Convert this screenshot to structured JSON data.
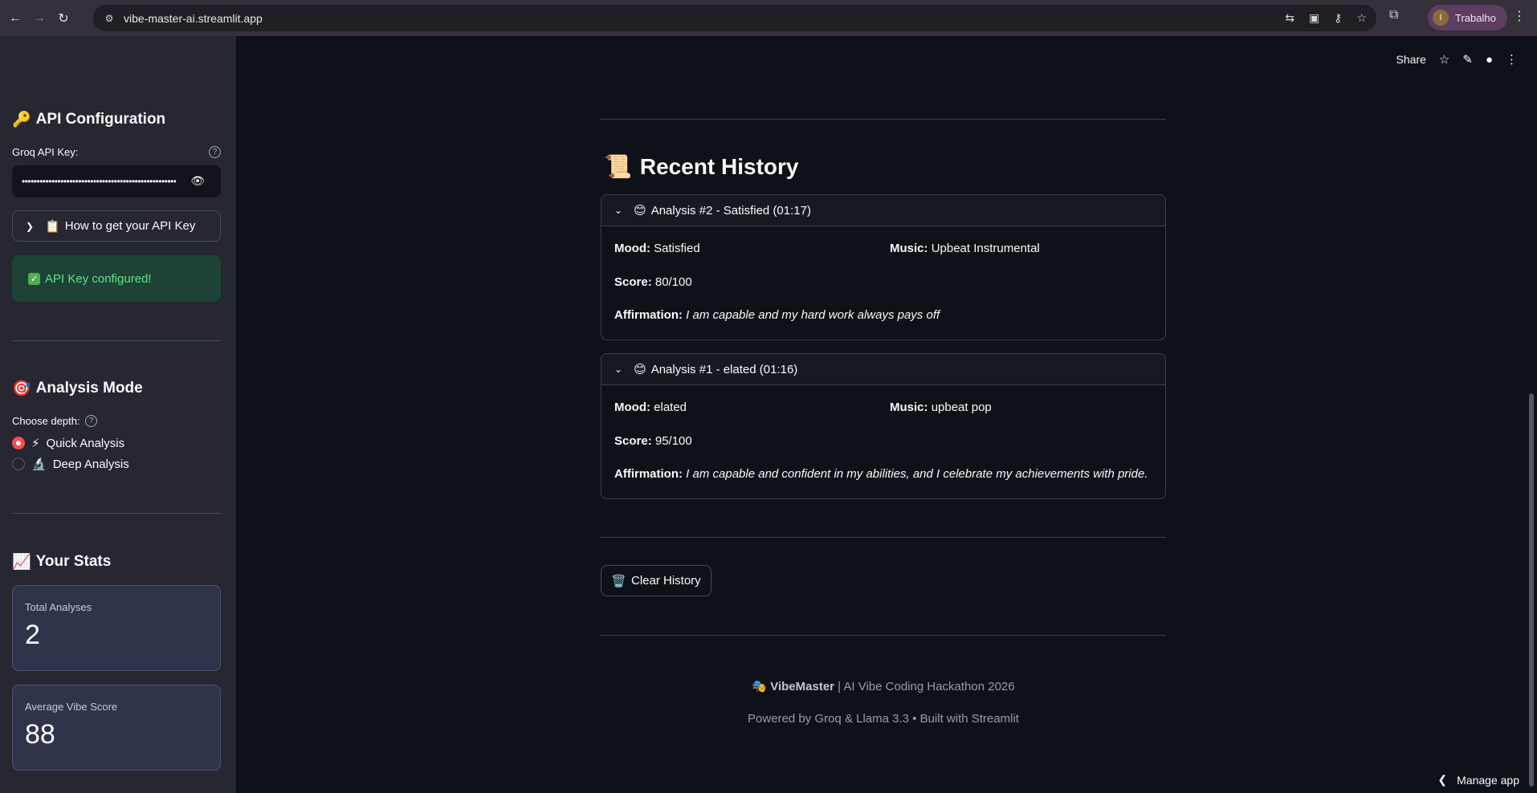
{
  "browser": {
    "url": "vibe-master-ai.streamlit.app",
    "profile_initial": "I",
    "profile_name": "Trabalho"
  },
  "sidebar": {
    "api": {
      "heading_emoji": "🔑",
      "heading": "API Configuration",
      "key_label": "Groq API Key:",
      "key_masked": "••••••••••••••••••••••••••••••••••••••••••••••••••••••",
      "howto_emoji": "📋",
      "howto_label": "How to get your API Key",
      "success_text": "API Key configured!"
    },
    "mode": {
      "heading_emoji": "🎯",
      "heading": "Analysis Mode",
      "depth_label": "Choose depth:",
      "options": [
        {
          "emoji": "⚡",
          "label": "Quick Analysis",
          "selected": true
        },
        {
          "emoji": "🔬",
          "label": "Deep Analysis",
          "selected": false
        }
      ]
    },
    "stats": {
      "heading_emoji": "📈",
      "heading": "Your Stats",
      "total_label": "Total Analyses",
      "total_value": "2",
      "avg_label": "Average Vibe Score",
      "avg_value": "88"
    }
  },
  "toolbar": {
    "share": "Share"
  },
  "main": {
    "history_emoji": "📜",
    "history_title": "Recent History",
    "entries": [
      {
        "emoji": "😊",
        "title": "Analysis #2 - Satisfied (01:17)",
        "mood_label": "Mood:",
        "mood": "Satisfied",
        "music_label": "Music:",
        "music": "Upbeat Instrumental",
        "score_label": "Score:",
        "score": "80/100",
        "affirmation_label": "Affirmation:",
        "affirmation": "I am capable and my hard work always pays off"
      },
      {
        "emoji": "😊",
        "title": "Analysis #1 - elated (01:16)",
        "mood_label": "Mood:",
        "mood": "elated",
        "music_label": "Music:",
        "music": "upbeat pop",
        "score_label": "Score:",
        "score": "95/100",
        "affirmation_label": "Affirmation:",
        "affirmation": "I am capable and confident in my abilities, and I celebrate my achievements with pride."
      }
    ],
    "clear_emoji": "🗑️",
    "clear_label": "Clear History",
    "footer_emoji": "🎭",
    "footer_brand": "VibeMaster",
    "footer_rest": " | AI Vibe Coding Hackathon 2026",
    "footer_powered": "Powered by Groq & Llama 3.3 • Built with Streamlit",
    "manage_label": "Manage app"
  }
}
